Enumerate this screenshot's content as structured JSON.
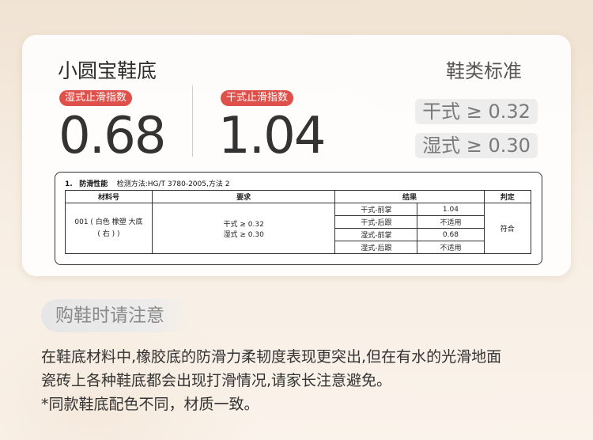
{
  "card": {
    "product_name": "小圆宝鞋底",
    "standard_title": "鞋类标准",
    "wet_label": "湿式止滑指数",
    "wet_value": "0.68",
    "dry_label": "干式止滑指数",
    "dry_value": "1.04",
    "std_dry": "干式 ≥ 0.32",
    "std_wet": "湿式 ≥ 0.30",
    "accent_color": "#e0504a"
  },
  "test_report": {
    "section_number": "1.",
    "section_title": "防滑性能",
    "method": "检测方法:HG/T 3780-2005,方法 2",
    "headers": [
      "材料号",
      "要求",
      "结果",
      "判定"
    ],
    "material_line1": "001 ( 白色  橡塑  大底",
    "material_line2": "( 右 ) )",
    "requirement_dry": "干式 ≥ 0.32",
    "requirement_wet": "湿式 ≥ 0.30",
    "results": [
      {
        "position": "干式-前掌",
        "value": "1.04"
      },
      {
        "position": "干式-后跟",
        "value": "不适用"
      },
      {
        "position": "湿式-前掌",
        "value": "0.68"
      },
      {
        "position": "湿式-后跟",
        "value": "不适用"
      }
    ],
    "verdict": "符合"
  },
  "notice": {
    "label": "购鞋时请注意",
    "line1": "在鞋底材料中,橡胶底的防滑力柔韧度表现更突出,但在有水的光滑地面",
    "line2": "瓷砖上各种鞋底都会出现打滑情况,请家长注意避免。",
    "line3": "*同款鞋底配色不同，材质一致。"
  }
}
